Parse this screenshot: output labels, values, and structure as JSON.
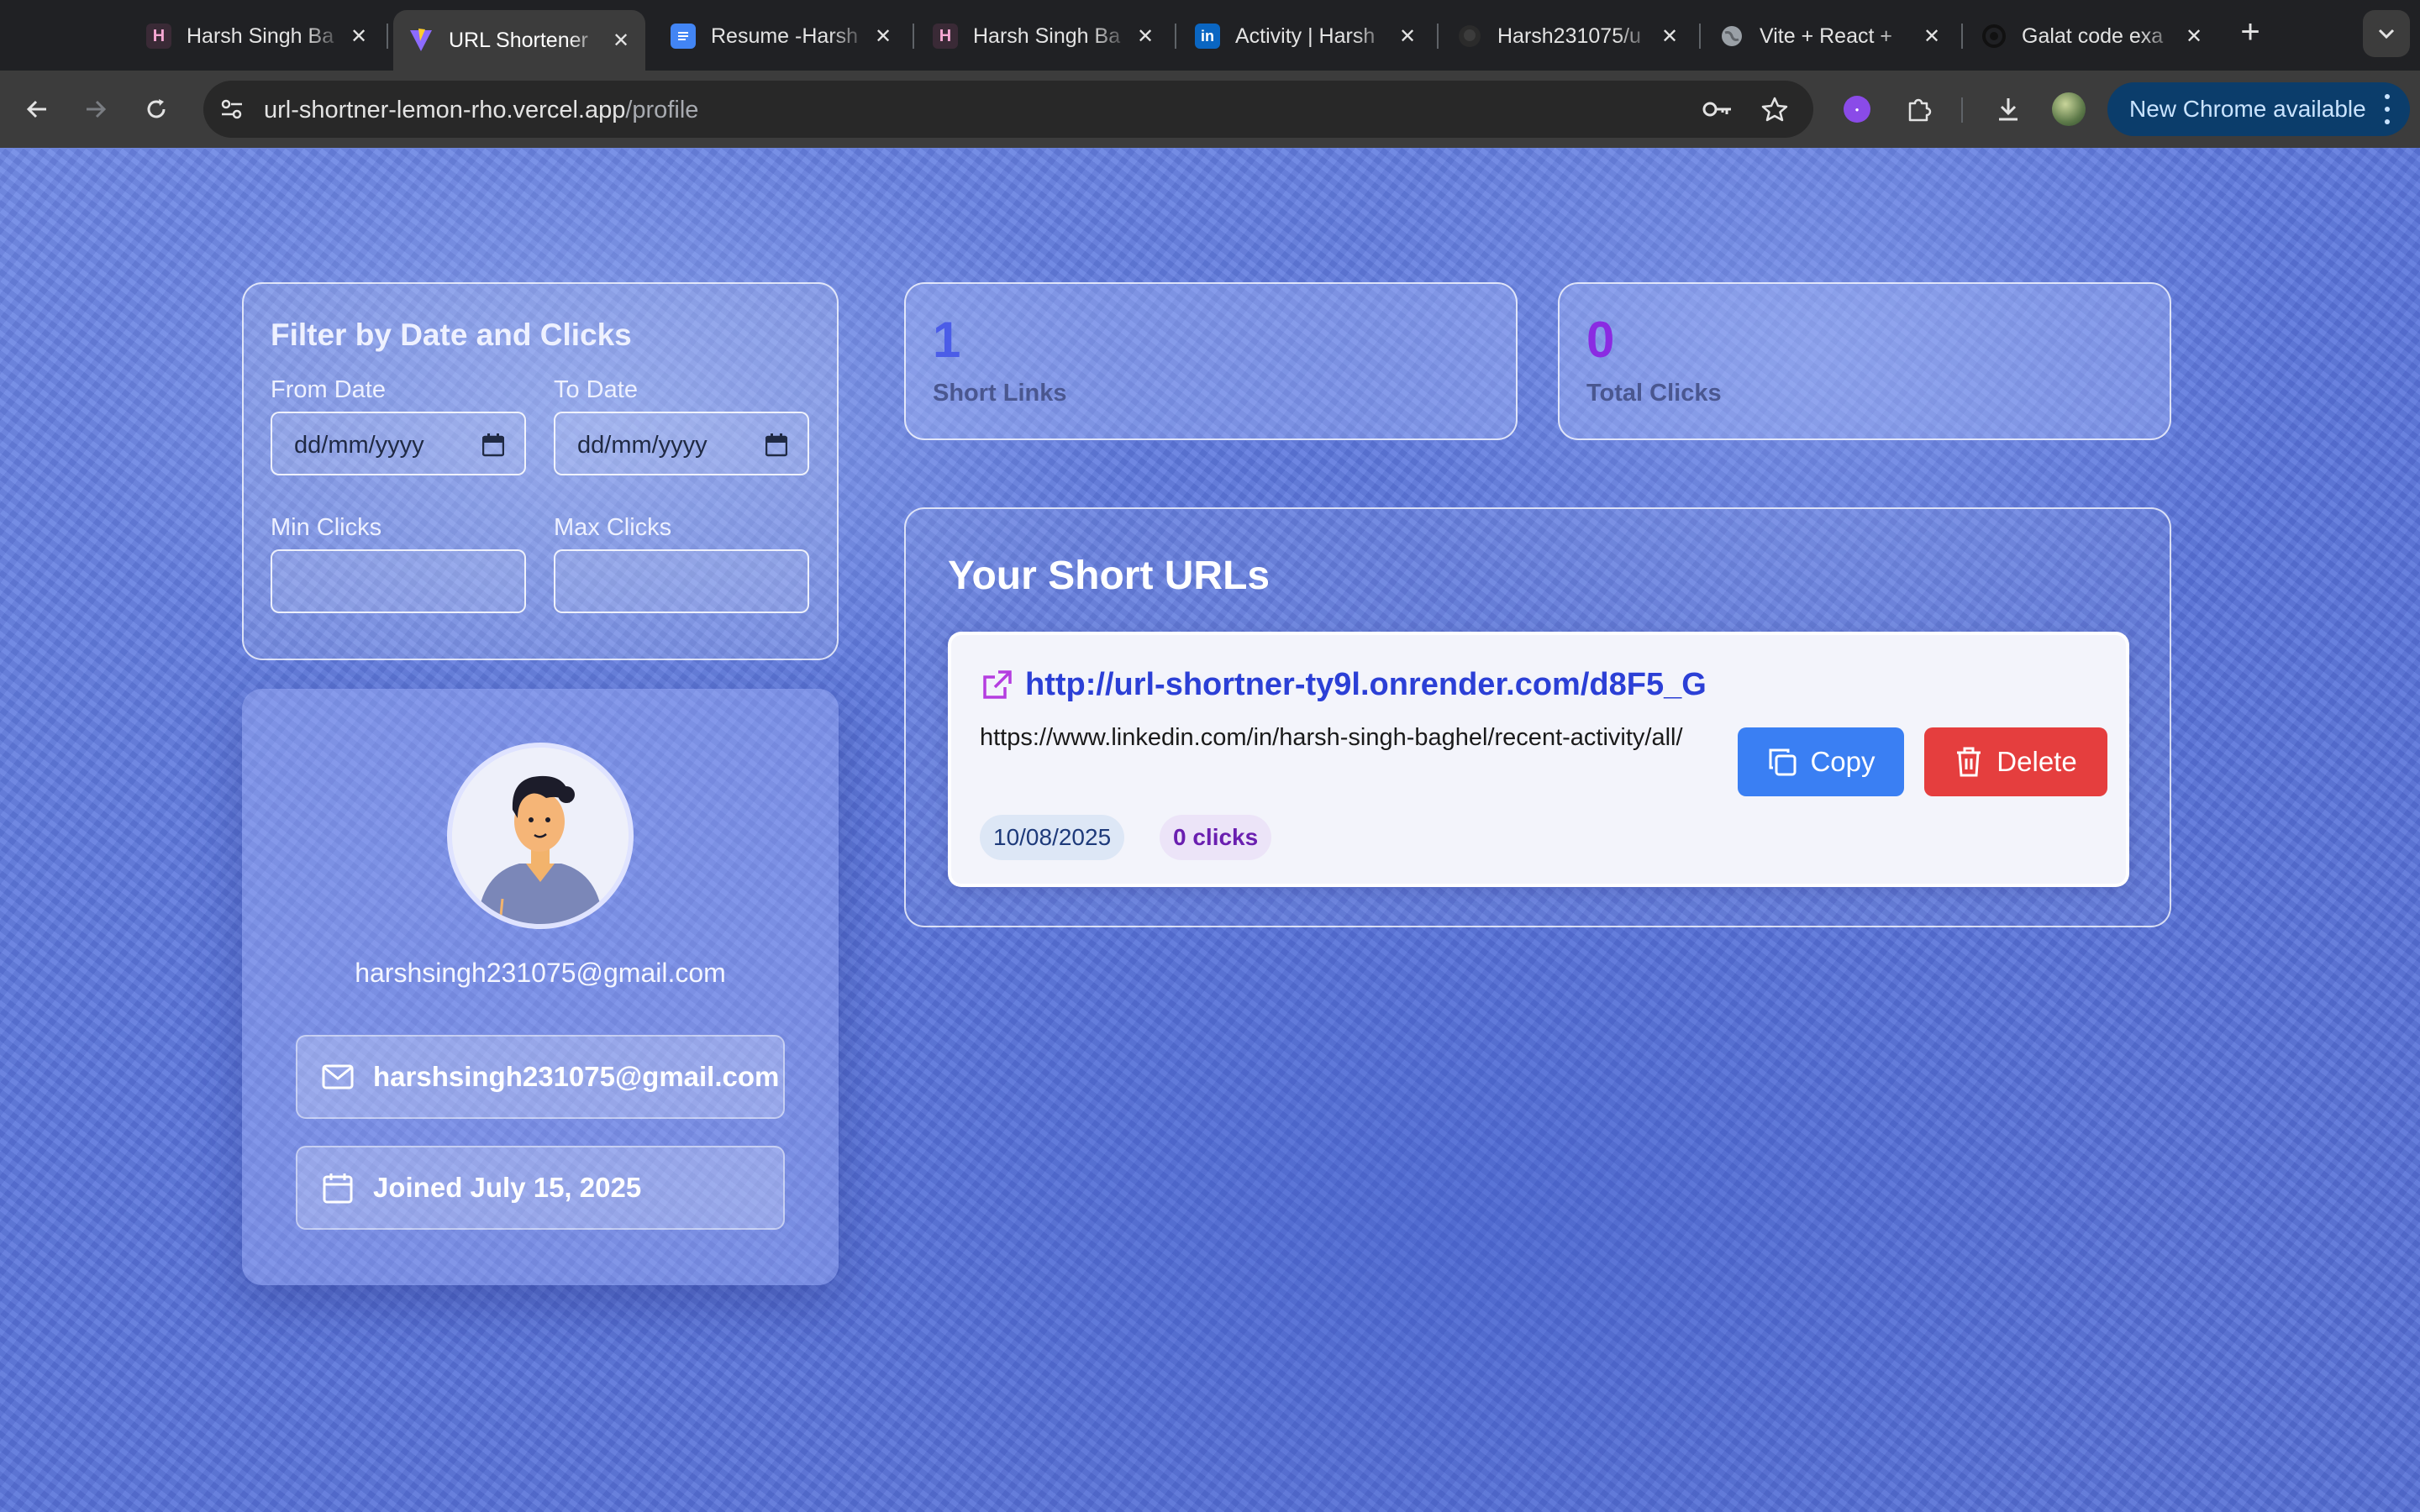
{
  "browser": {
    "tabs": [
      {
        "title": "Harsh Singh Ba",
        "icon": "pink-h-logo-icon",
        "active": false
      },
      {
        "title": "URL Shortener",
        "icon": "vite-logo-icon",
        "active": true
      },
      {
        "title": "Resume -Harsh",
        "icon": "google-docs-icon",
        "active": false
      },
      {
        "title": "Harsh Singh Ba",
        "icon": "pink-h-logo-icon",
        "active": false
      },
      {
        "title": "Activity | Harsh",
        "icon": "linkedin-icon",
        "active": false
      },
      {
        "title": "Harsh231075/u",
        "icon": "github-icon",
        "active": false
      },
      {
        "title": "Vite + React +",
        "icon": "globe-icon",
        "active": false
      },
      {
        "title": "Galat code exa",
        "icon": "chatgpt-icon",
        "active": false
      }
    ],
    "url_host": "url-shortner-lemon-rho.vercel.app",
    "url_path": "/profile",
    "update_label": "New Chrome available"
  },
  "filter": {
    "title": "Filter by Date and Clicks",
    "from_label": "From Date",
    "to_label": "To Date",
    "date_placeholder": "dd/mm/yyyy",
    "min_label": "Min Clicks",
    "max_label": "Max Clicks",
    "min_value": "",
    "max_value": ""
  },
  "profile": {
    "email_heading": "harshsingh231075@gmail.com",
    "email": "harshsingh231075@gmail.com",
    "joined": "Joined July 15, 2025"
  },
  "stats": {
    "short_links_value": "1",
    "short_links_label": "Short Links",
    "total_clicks_value": "0",
    "total_clicks_label": "Total Clicks"
  },
  "urls": {
    "title": "Your Short URLs",
    "items": [
      {
        "short_url": "http://url-shortner-ty9l.onrender.com/d8F5_G",
        "long_url": "https://www.linkedin.com/in/harsh-singh-baghel/recent-activity/all/",
        "date": "10/08/2025",
        "clicks": "0 clicks",
        "copy_label": "Copy",
        "delete_label": "Delete"
      }
    ]
  },
  "colors": {
    "accent_blue": "#3a7ff3",
    "danger_red": "#e53e3e",
    "stat_blue": "#4b5de8",
    "stat_purple": "#8a2be2",
    "link_blue": "#2b3fd6"
  }
}
